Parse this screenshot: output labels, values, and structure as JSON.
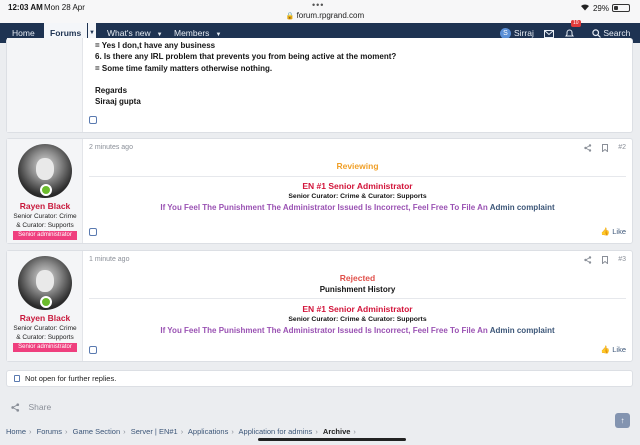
{
  "status_bar": {
    "time": "12:03 AM",
    "date": "Mon 28 Apr",
    "dots": "•••",
    "url": "forum.rpgrand.com",
    "battery_text": "29%",
    "battery_level": 0.29
  },
  "nav": {
    "items": [
      {
        "label": "Home"
      },
      {
        "label": "Forums"
      },
      {
        "label": "What's new"
      },
      {
        "label": "Members"
      }
    ],
    "user": "Sirraj",
    "user_initial": "S",
    "alerts_badge": "10",
    "search_label": "Search"
  },
  "post1": {
    "lines": [
      "= Yes I don,t have any business",
      "6. Is there any IRL problem that prevents you from being active at the moment?",
      "= Some time family matters otherwise nothing.",
      "",
      "Regards",
      "Siraaj gupta"
    ]
  },
  "post2": {
    "time": "2 minutes ago",
    "number": "#2",
    "username": "Rayen Black",
    "user_title_1": "Senior Curator: Crime",
    "user_title_2": "& Curator: Supports",
    "banner": "Senior administrator",
    "status": "Reviewing",
    "heading": "EN #1 Senior Administrator",
    "subheading": "Senior Curator: Crime & Curator: Supports",
    "notice": "If You Feel The Punishment The Administrator Issued Is Incorrect, Feel Free To File An",
    "notice_link": "Admin complaint",
    "like": "Like"
  },
  "post3": {
    "time": "1 minute ago",
    "number": "#3",
    "username": "Rayen Black",
    "user_title_1": "Senior Curator: Crime",
    "user_title_2": "& Curator: Supports",
    "banner": "Senior administrator",
    "status": "Rejected",
    "subtitle": "Punishment History",
    "heading": "EN #1 Senior Administrator",
    "subheading": "Senior Curator: Crime & Curator: Supports",
    "notice": "If You Feel The Punishment The Administrator Issued Is Incorrect, Feel Free To File An",
    "notice_link": "Admin complaint",
    "like": "Like"
  },
  "closed_notice": "Not open for further replies.",
  "share_label": "Share",
  "breadcrumbs": [
    "Home",
    "Forums",
    "Game Section",
    "Server | EN#1",
    "Applications",
    "Application for admins",
    "Archive"
  ],
  "colors": {
    "nav_bg": "#1e3352",
    "username": "#c8193c",
    "reviewing": "#f0a02a",
    "rejected": "#e0504a",
    "notice": "#9a52b3",
    "banner": "#ef3f7e"
  }
}
